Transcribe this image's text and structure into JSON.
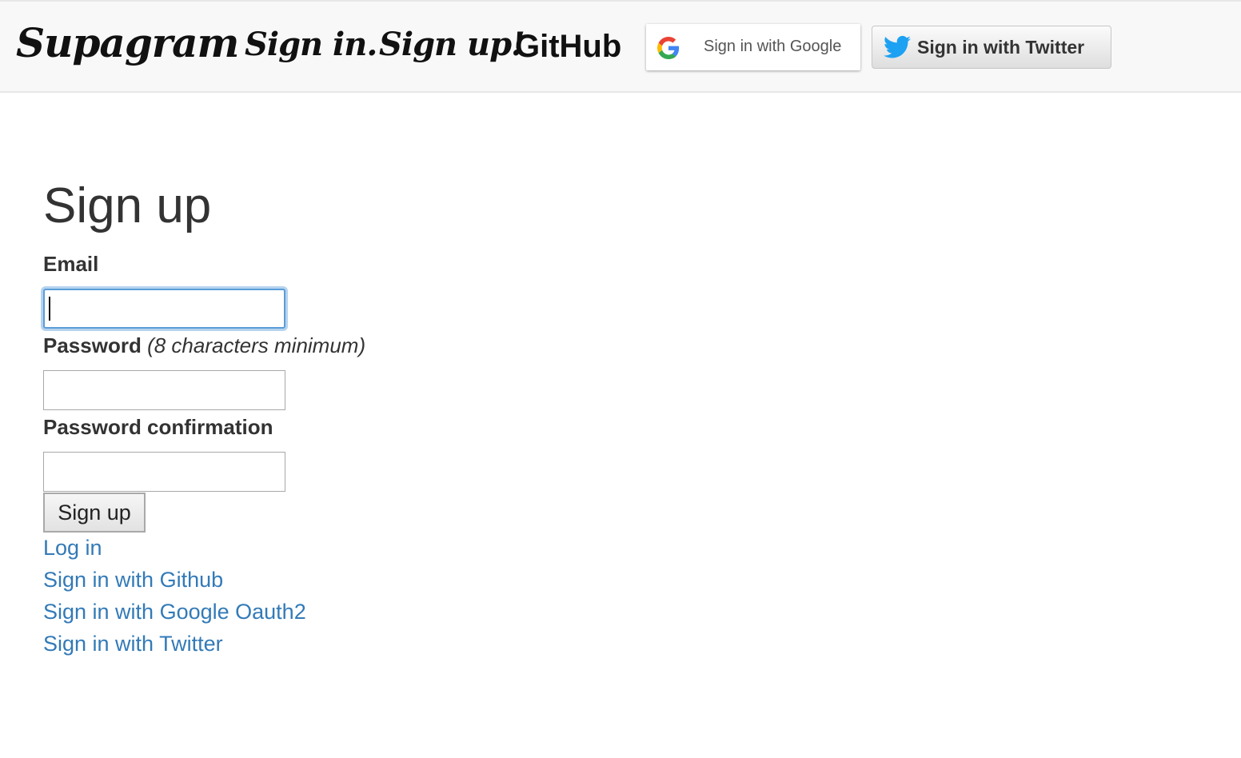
{
  "navbar": {
    "brand": "Supagram",
    "sign_in": "Sign in.",
    "sign_up": "Sign up!",
    "github": "GitHub",
    "google_button": {
      "label": "Sign in with Google",
      "icon": "google-g-icon"
    },
    "twitter_button": {
      "label": "Sign in with Twitter",
      "icon": "twitter-bird-icon"
    }
  },
  "form": {
    "title": "Sign up",
    "email_label": "Email",
    "email_value": "",
    "password_label": "Password",
    "password_hint": "(8 characters minimum)",
    "password_value": "",
    "confirmation_label": "Password confirmation",
    "confirmation_value": "",
    "submit_label": "Sign up"
  },
  "links": {
    "log_in": "Log in",
    "github": "Sign in with Github",
    "google": "Sign in with Google Oauth2",
    "twitter": "Sign in with Twitter"
  },
  "colors": {
    "link": "#337ab7",
    "focus": "#5b9dd9",
    "twitter_blue": "#1da1f2",
    "navbar_bg": "#f8f8f8"
  }
}
